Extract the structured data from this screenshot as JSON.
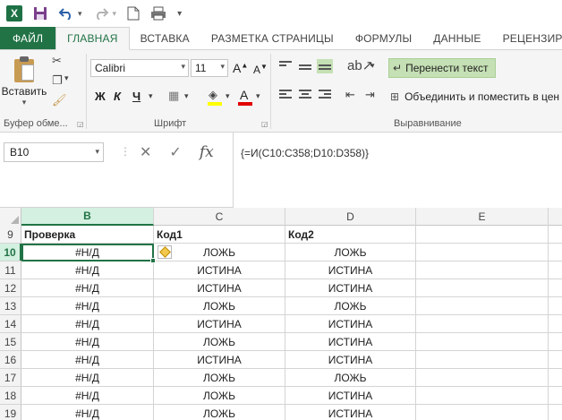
{
  "qat": {
    "app_icon_letter": "X",
    "icons": [
      "save-icon",
      "undo-icon",
      "redo-icon",
      "new-document-icon",
      "print-preview-icon",
      "customize-icon"
    ]
  },
  "tabs": [
    {
      "label": "ФАЙЛ",
      "type": "file"
    },
    {
      "label": "ГЛАВНАЯ",
      "type": "active"
    },
    {
      "label": "ВСТАВКА",
      "type": "normal"
    },
    {
      "label": "РАЗМЕТКА СТРАНИЦЫ",
      "type": "normal"
    },
    {
      "label": "ФОРМУЛЫ",
      "type": "normal"
    },
    {
      "label": "ДАННЫЕ",
      "type": "normal"
    },
    {
      "label": "РЕЦЕНЗИРО",
      "type": "normal"
    }
  ],
  "ribbon": {
    "paste_label": "Вставить",
    "clipboard_group": "Буфер обме...",
    "font_group": "Шрифт",
    "alignment_group": "Выравнивание",
    "font_name": "Calibri",
    "font_size": "11",
    "bold": "Ж",
    "italic": "К",
    "underline": "Ч",
    "grow_font": "A",
    "shrink_font": "A",
    "font_color_letter": "A",
    "wrap_text": "Перенести текст",
    "merge_center": "Объединить и поместить в цен",
    "accent_color": "#217346",
    "highlight_color": "#c5e0b4"
  },
  "formula_bar": {
    "name_box": "B10",
    "formula": "{=И(C10:C358;D10:D358)}",
    "fx_label": "fx"
  },
  "grid": {
    "columns": [
      "B",
      "C",
      "D",
      "E"
    ],
    "selected_column": "B",
    "rows": [
      {
        "num": "9",
        "b": "Проверка",
        "c": "Код1",
        "d": "Код2",
        "header": true
      },
      {
        "num": "10",
        "b": "#Н/Д",
        "c": "ЛОЖЬ",
        "d": "ЛОЖЬ",
        "selected": true
      },
      {
        "num": "11",
        "b": "#Н/Д",
        "c": "ИСТИНА",
        "d": "ИСТИНА"
      },
      {
        "num": "12",
        "b": "#Н/Д",
        "c": "ИСТИНА",
        "d": "ИСТИНА"
      },
      {
        "num": "13",
        "b": "#Н/Д",
        "c": "ЛОЖЬ",
        "d": "ЛОЖЬ"
      },
      {
        "num": "14",
        "b": "#Н/Д",
        "c": "ИСТИНА",
        "d": "ИСТИНА"
      },
      {
        "num": "15",
        "b": "#Н/Д",
        "c": "ЛОЖЬ",
        "d": "ИСТИНА"
      },
      {
        "num": "16",
        "b": "#Н/Д",
        "c": "ИСТИНА",
        "d": "ИСТИНА"
      },
      {
        "num": "17",
        "b": "#Н/Д",
        "c": "ЛОЖЬ",
        "d": "ЛОЖЬ"
      },
      {
        "num": "18",
        "b": "#Н/Д",
        "c": "ЛОЖЬ",
        "d": "ИСТИНА"
      },
      {
        "num": "19",
        "b": "#Н/Д",
        "c": "ЛОЖЬ",
        "d": "ИСТИНА"
      }
    ]
  }
}
